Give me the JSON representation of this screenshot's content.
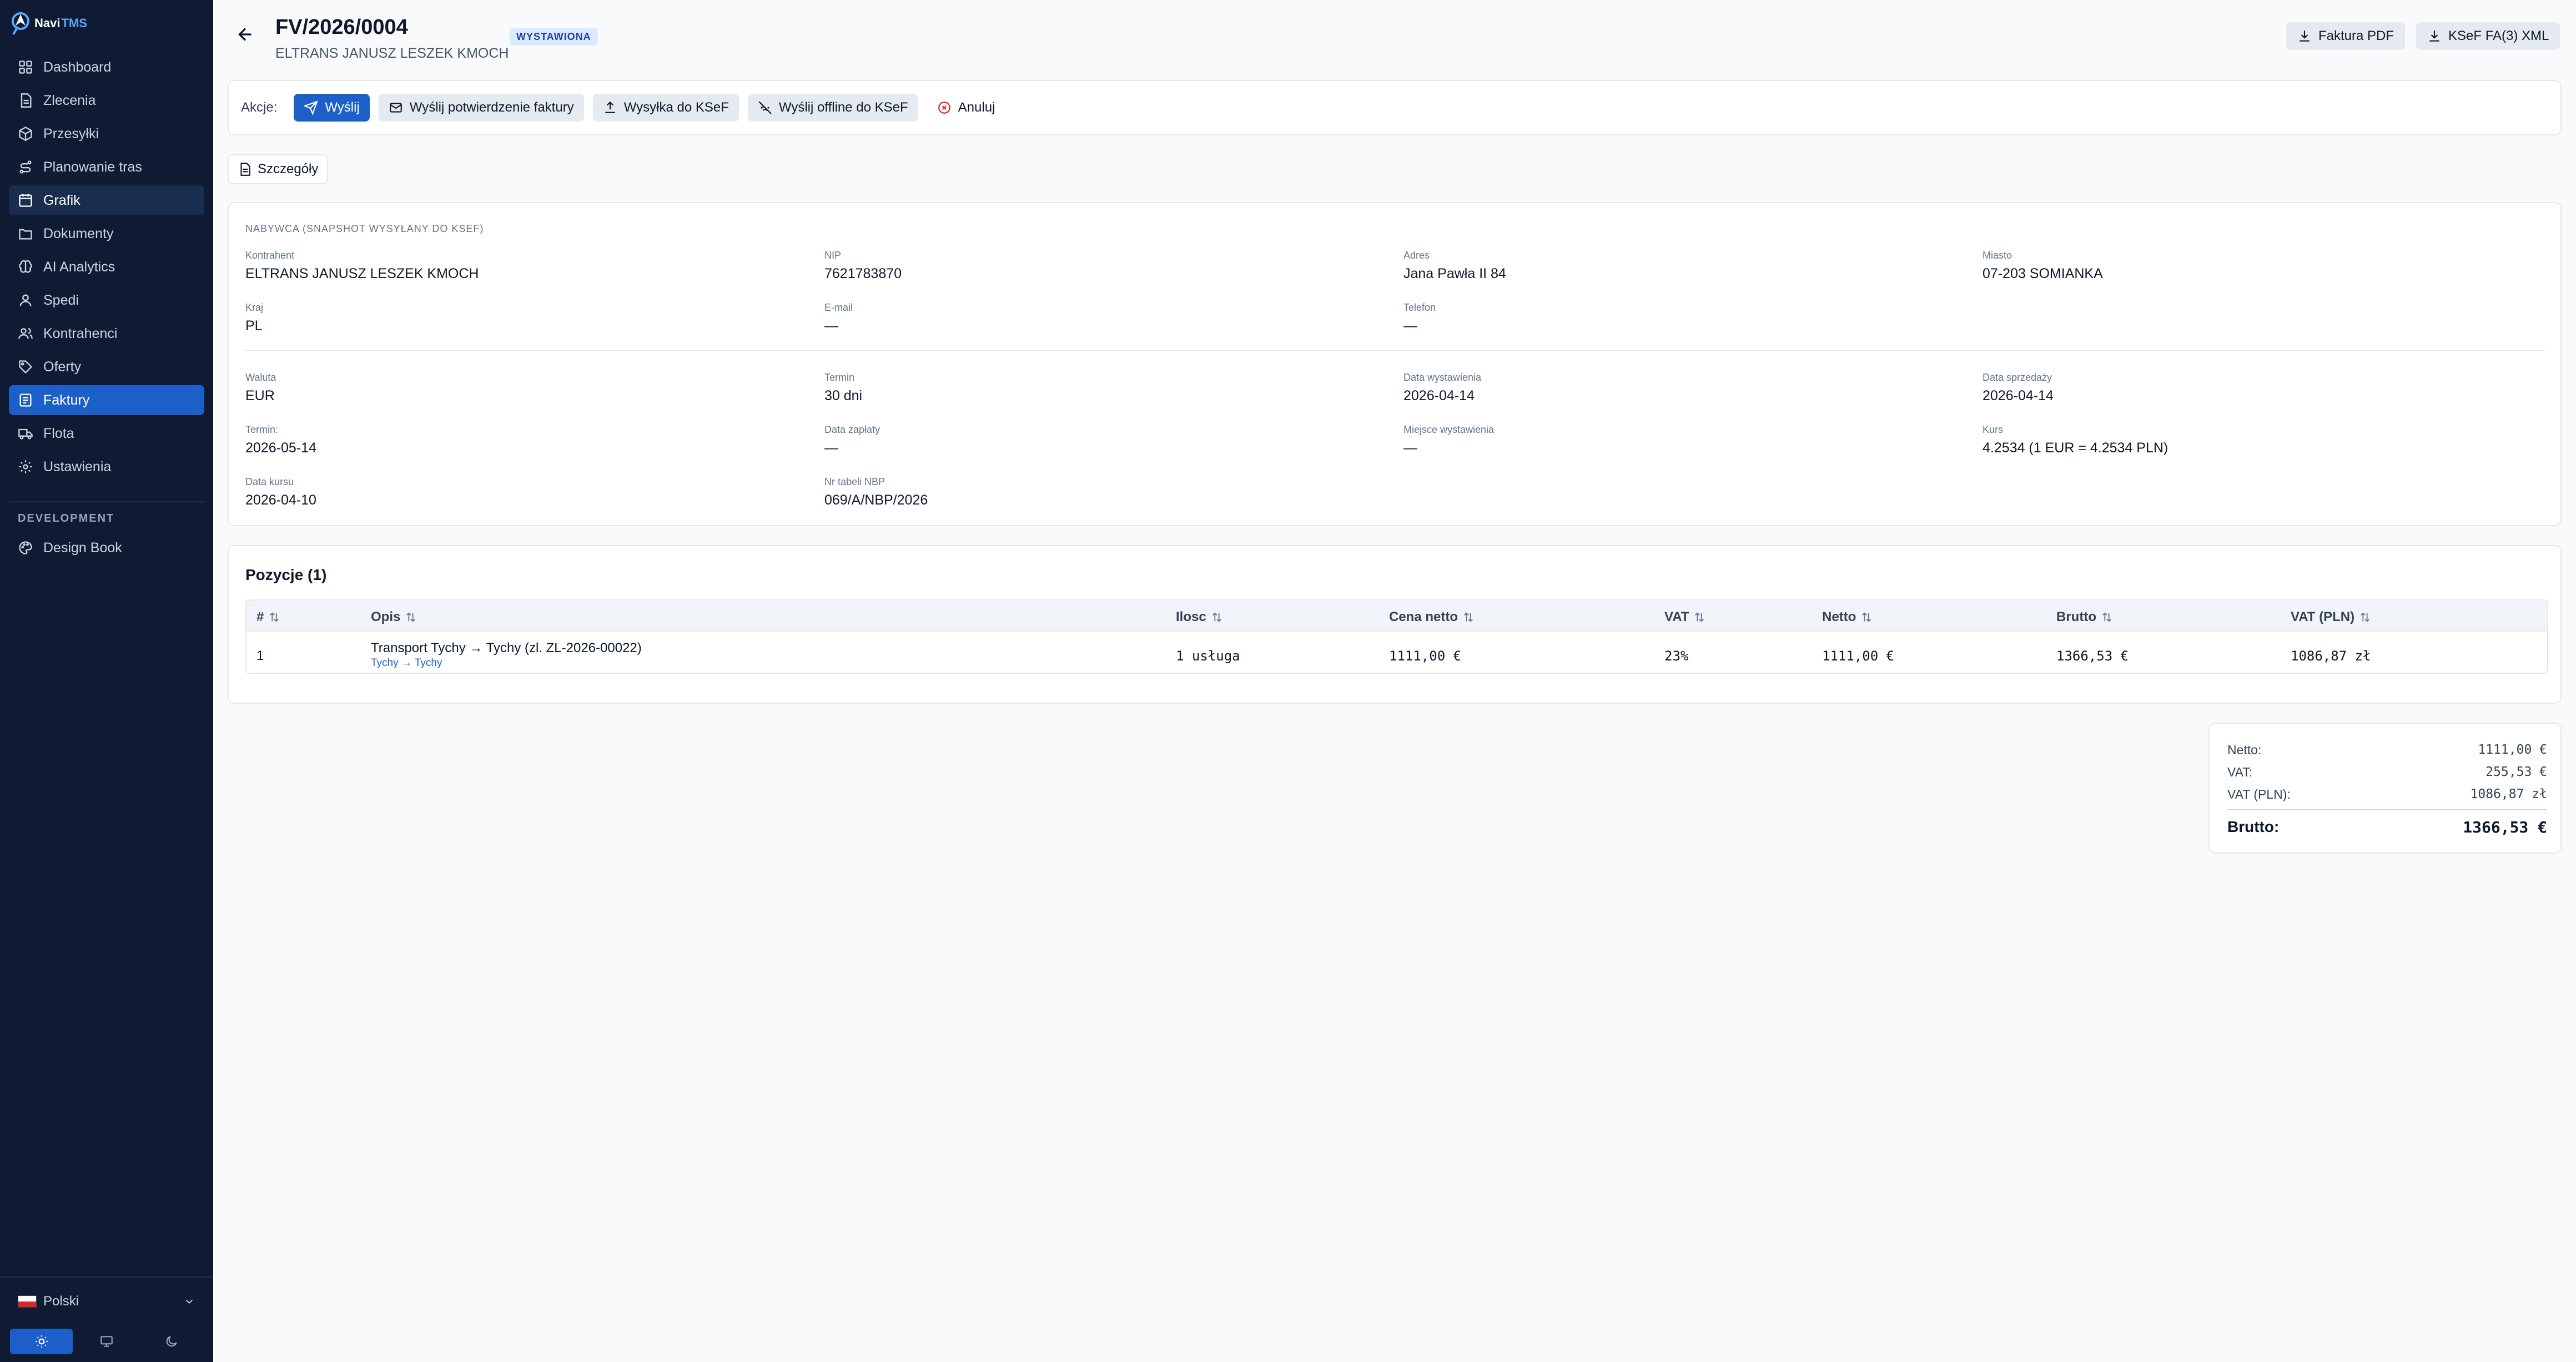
{
  "brand": {
    "name": "Navi",
    "suffix": "TMS"
  },
  "sidebar": {
    "items": [
      {
        "label": "Dashboard",
        "icon": "dashboard-icon"
      },
      {
        "label": "Zlecenia",
        "icon": "document-icon"
      },
      {
        "label": "Przesyłki",
        "icon": "package-icon"
      },
      {
        "label": "Planowanie tras",
        "icon": "route-icon"
      },
      {
        "label": "Grafik",
        "icon": "calendar-icon"
      },
      {
        "label": "Dokumenty",
        "icon": "folder-icon"
      },
      {
        "label": "AI Analytics",
        "icon": "brain-icon"
      },
      {
        "label": "Spedi",
        "icon": "user-icon"
      },
      {
        "label": "Kontrahenci",
        "icon": "users-icon"
      },
      {
        "label": "Oferty",
        "icon": "tag-icon"
      },
      {
        "label": "Faktury",
        "icon": "invoice-icon"
      },
      {
        "label": "Flota",
        "icon": "truck-icon"
      },
      {
        "label": "Ustawienia",
        "icon": "gear-icon"
      }
    ],
    "dev_title": "DEVELOPMENT",
    "dev_item": "Design Book",
    "language": "Polski",
    "colors": {
      "bg": "#0e1b33",
      "active": "#1d5fc9"
    }
  },
  "header": {
    "title": "FV/2026/0004",
    "badge": "WYSTAWIONA",
    "subtitle": "ELTRANS JANUSZ LESZEK KMOCH",
    "pdf_button": "Faktura PDF",
    "xml_button": "KSeF FA(3) XML"
  },
  "actions": {
    "label": "Akcje:",
    "send": "Wyślij",
    "send_confirmation": "Wyślij potwierdzenie faktury",
    "ksef_send": "Wysyłka do KSeF",
    "offline_send": "Wyślij offline do KSeF",
    "cancel": "Anuluj"
  },
  "tab": {
    "details": "Szczegóły"
  },
  "buyer": {
    "section_title": "NABYWCA (SNAPSHOT WYSYŁANY DO KSEF)",
    "kontrahent_label": "Kontrahent",
    "kontrahent": "ELTRANS JANUSZ LESZEK KMOCH",
    "nip_label": "NIP",
    "nip": "7621783870",
    "adres_label": "Adres",
    "adres": "Jana Pawła II 84",
    "miasto_label": "Miasto",
    "miasto": "07-203 SOMIANKA",
    "kraj_label": "Kraj",
    "kraj": "PL",
    "email_label": "E-mail",
    "email": "—",
    "telefon_label": "Telefon",
    "telefon": "—"
  },
  "invoice": {
    "waluta_label": "Waluta",
    "waluta": "EUR",
    "termin_label": "Termin",
    "termin": "30 dni",
    "data_wyst_label": "Data wystawienia",
    "data_wyst": "2026-04-14",
    "data_sprz_label": "Data sprzedaży",
    "data_sprz": "2026-04-14",
    "termin2_label": "Termin:",
    "termin2": "2026-05-14",
    "data_zapl_label": "Data zapłaty",
    "data_zapl": "—",
    "miejsce_label": "Miejsce wystawienia",
    "miejsce": "—",
    "kurs_label": "Kurs",
    "kurs": "4.2534 (1 EUR = 4.2534 PLN)",
    "data_kursu_label": "Data kursu",
    "data_kursu": "2026-04-10",
    "nbp_label": "Nr tabeli NBP",
    "nbp": "069/A/NBP/2026"
  },
  "positions": {
    "title": "Pozycje (1)",
    "columns": [
      "#",
      "Opis",
      "Ilosc",
      "Cena netto",
      "VAT",
      "Netto",
      "Brutto",
      "VAT (PLN)"
    ],
    "rows": [
      {
        "no": "1",
        "desc": "Transport Tychy → Tychy (zl. ZL-2026-00022)",
        "route": "Tychy → Tychy",
        "qty": "1 usługa",
        "price": "1111,00 €",
        "vat": "23%",
        "net": "1111,00 €",
        "gross": "1366,53 €",
        "vat_pln": "1086,87 zł"
      }
    ]
  },
  "summary": {
    "netto_label": "Netto:",
    "netto": "1111,00 €",
    "vat_label": "VAT:",
    "vat": "255,53 €",
    "vat_pln_label": "VAT (PLN):",
    "vat_pln": "1086,87 zł",
    "brutto_label": "Brutto:",
    "brutto": "1366,53 €"
  }
}
